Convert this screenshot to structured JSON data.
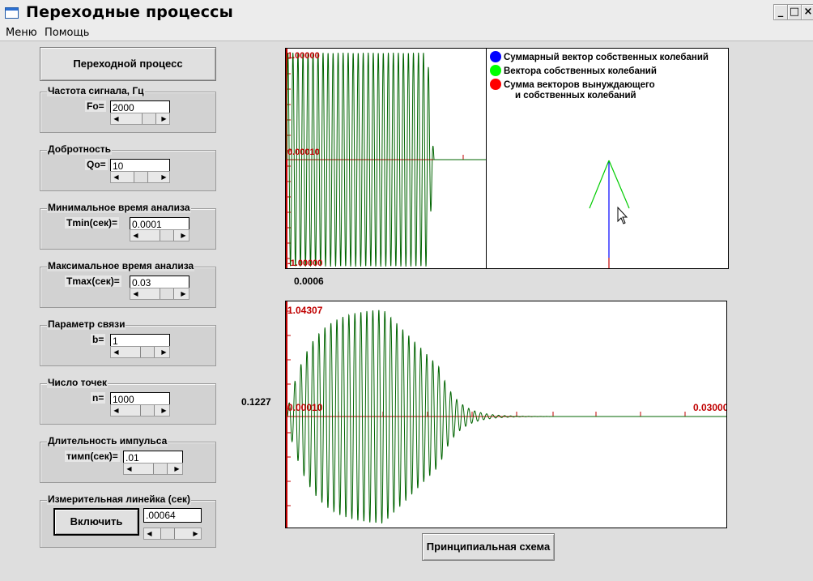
{
  "window": {
    "title": "Переходные процессы"
  },
  "menu": {
    "items": [
      "Меню",
      "Помощь"
    ]
  },
  "buttons": {
    "transient": "Переходной процесс",
    "enable": "Включить",
    "schematic": "Принципиальная схема"
  },
  "groups": [
    {
      "legend": "Частота сигнала, Гц",
      "label": "Fo=",
      "value": "2000"
    },
    {
      "legend": "Добротность",
      "label": "Qo=",
      "value": "10"
    },
    {
      "legend": "Минимальное время анализа",
      "label": "Tmin(сек)=",
      "value": "0.0001"
    },
    {
      "legend": "Максимальное время анализа",
      "label": "Tmax(сек)=",
      "value": "0.03"
    },
    {
      "legend": "Параметр связи",
      "label": "b=",
      "value": "1"
    },
    {
      "legend": "Число точек",
      "label": "n=",
      "value": "1000"
    },
    {
      "legend": "Длительность импульса",
      "label": "тимп(сек)=",
      "value": ".01"
    },
    {
      "legend": "Измерительная линейка (сек)",
      "value": ".00064"
    }
  ],
  "top_plot": {
    "ymax": "1.00000",
    "ymid": "0.00010",
    "ymin": "-1.00000",
    "readout": "0.0006"
  },
  "legend": {
    "items": [
      {
        "text": "Суммарный вектор собственных колебаний",
        "color": "#0000ff"
      },
      {
        "text": "Вектора собственных колебаний",
        "color": "#00ff00"
      },
      {
        "text": "Сумма векторов вынуждающего",
        "color": "#ff0000"
      }
    ],
    "continuation": "и собственных колебаний"
  },
  "bottom_plot": {
    "ymax": "1.04307",
    "xmin": "0.00010",
    "xmax": "0.03000",
    "readout": "0.1227"
  },
  "colors": {
    "wave": "#006400",
    "axis": "#c00000",
    "vector_sum": "#0000ff",
    "vector_own": "#00cc00"
  }
}
